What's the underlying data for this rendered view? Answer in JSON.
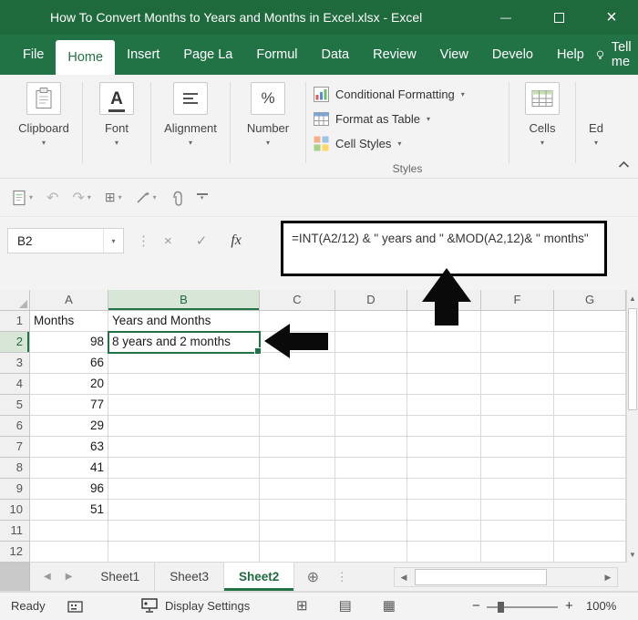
{
  "window": {
    "title": "How To Convert Months to Years and Months in Excel.xlsx  -  Excel"
  },
  "menu": {
    "items": [
      "File",
      "Home",
      "Insert",
      "Page La",
      "Formul",
      "Data",
      "Review",
      "View",
      "Develo",
      "Help"
    ],
    "active": "Home",
    "tell_me": "Tell me"
  },
  "ribbon": {
    "big_buttons": [
      {
        "label": "Clipboard",
        "icon": "clipboard-icon"
      },
      {
        "label": "Font",
        "icon": "font-icon"
      },
      {
        "label": "Alignment",
        "icon": "alignment-icon"
      },
      {
        "label": "Number",
        "icon": "number-icon"
      }
    ],
    "styles_group": {
      "items": [
        {
          "label": "Conditional Formatting",
          "icon": "conditional-formatting-icon"
        },
        {
          "label": "Format as Table",
          "icon": "format-as-table-icon"
        },
        {
          "label": "Cell Styles",
          "icon": "cell-styles-icon"
        }
      ],
      "label": "Styles"
    },
    "cells_button": {
      "label": "Cells",
      "icon": "cells-icon"
    },
    "editing_button": {
      "label": "Ed"
    }
  },
  "formula_bar": {
    "name_box": "B2",
    "formula": "=INT(A2/12) & \" years and \" &MOD(A2,12)& \" months\""
  },
  "grid": {
    "columns": [
      "A",
      "B",
      "C",
      "D",
      "E",
      "F",
      "G"
    ],
    "selected_column": "B",
    "selected_row": 2,
    "active_cell": "B2",
    "rows": [
      {
        "n": 1,
        "cells": {
          "A": "Months",
          "B": "Years and Months"
        }
      },
      {
        "n": 2,
        "cells": {
          "A": "98",
          "B": "8 years and 2 months"
        }
      },
      {
        "n": 3,
        "cells": {
          "A": "66"
        }
      },
      {
        "n": 4,
        "cells": {
          "A": "20"
        }
      },
      {
        "n": 5,
        "cells": {
          "A": "77"
        }
      },
      {
        "n": 6,
        "cells": {
          "A": "29"
        }
      },
      {
        "n": 7,
        "cells": {
          "A": "63"
        }
      },
      {
        "n": 8,
        "cells": {
          "A": "41"
        }
      },
      {
        "n": 9,
        "cells": {
          "A": "96"
        }
      },
      {
        "n": 10,
        "cells": {
          "A": "51"
        }
      },
      {
        "n": 11,
        "cells": {}
      },
      {
        "n": 12,
        "cells": {}
      }
    ]
  },
  "sheets": {
    "tabs": [
      "Sheet1",
      "Sheet3",
      "Sheet2"
    ],
    "active": "Sheet2"
  },
  "status_bar": {
    "ready": "Ready",
    "display_settings": "Display Settings",
    "zoom_level": "100%"
  },
  "icon_glyphs": {
    "dropdown-chevron-icon": "▾",
    "undo-icon": "↶",
    "redo-icon": "↷",
    "cancel-icon": "×",
    "enter-icon": "✓",
    "formula-fx-icon": "fx",
    "name-box-dots-icon": "⋮",
    "add-sheet-icon": "⊕",
    "sheet-handle-icon": "⋮",
    "scroll-up-icon": "▲",
    "scroll-down-icon": "▼",
    "scroll-left-icon": "◀",
    "scroll-right-icon": "▶",
    "tab-nav-left-icon": "◀",
    "tab-nav-right-icon": "▶",
    "normal-view-icon": "⊞",
    "page-layout-view-icon": "▤",
    "page-break-view-icon": "▦",
    "zoom-out-icon": "−",
    "zoom-in-icon": "+",
    "ribbon-scroll-right-icon": "›",
    "minimize-icon": "—",
    "close-icon": "×",
    "qat-borders-icon": "⊞"
  },
  "colors": {
    "excel_green": "#217346",
    "titlebar_green": "#1e6a3d",
    "selection_green": "#217346",
    "selected_header_bg": "#d8e6d8",
    "annotation_black": "#0a0a0a"
  }
}
